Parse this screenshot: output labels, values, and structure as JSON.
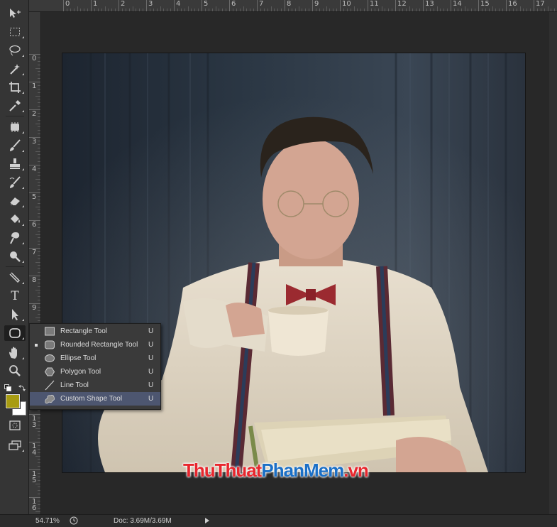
{
  "toolbar": {
    "tools": [
      {
        "name": "move-tool-icon"
      },
      {
        "name": "rectangular-marquee-tool-icon"
      },
      {
        "name": "lasso-tool-icon"
      },
      {
        "name": "magic-wand-tool-icon"
      },
      {
        "name": "crop-tool-icon"
      },
      {
        "name": "eyedropper-tool-icon"
      },
      {
        "name": "healing-brush-tool-icon"
      },
      {
        "name": "brush-tool-icon"
      },
      {
        "name": "clone-stamp-tool-icon"
      },
      {
        "name": "history-brush-tool-icon"
      },
      {
        "name": "eraser-tool-icon"
      },
      {
        "name": "paint-bucket-tool-icon"
      },
      {
        "name": "blur-tool-icon"
      },
      {
        "name": "dodge-tool-icon"
      },
      {
        "name": "pen-tool-icon"
      },
      {
        "name": "type-tool-icon"
      },
      {
        "name": "path-selection-tool-icon"
      },
      {
        "name": "shape-tool-icon"
      },
      {
        "name": "hand-tool-icon"
      },
      {
        "name": "zoom-tool-icon"
      }
    ],
    "type_tool_glyph": "T",
    "foreground_color": "#a89c12",
    "background_color": "#ffffff"
  },
  "ruler_top": [
    "0",
    "1",
    "2",
    "3",
    "4",
    "5",
    "6",
    "7",
    "8",
    "9",
    "10",
    "11",
    "12",
    "13",
    "14",
    "15",
    "16",
    "17"
  ],
  "ruler_left": [
    "0",
    "1",
    "2",
    "3",
    "4",
    "5",
    "6",
    "7",
    "8",
    "9",
    "1\n0",
    "1\n1",
    "1\n2",
    "1\n3",
    "1\n4",
    "1\n5",
    "1\n6"
  ],
  "flyout": {
    "items": [
      {
        "label": "Rectangle Tool",
        "key": "U",
        "icon": "rectangle-icon"
      },
      {
        "label": "Rounded Rectangle Tool",
        "key": "U",
        "icon": "rounded-rectangle-icon",
        "current": true
      },
      {
        "label": "Ellipse Tool",
        "key": "U",
        "icon": "ellipse-icon"
      },
      {
        "label": "Polygon Tool",
        "key": "U",
        "icon": "polygon-icon"
      },
      {
        "label": "Line Tool",
        "key": "U",
        "icon": "line-icon"
      },
      {
        "label": "Custom Shape Tool",
        "key": "U",
        "icon": "custom-shape-icon",
        "hover": true
      }
    ]
  },
  "status": {
    "zoom": "54.71%",
    "doc": "Doc: 3.69M/3.69M"
  },
  "watermark": {
    "part1": "ThuThuat",
    "part2": "PhanMem",
    "part3": ".vn"
  }
}
